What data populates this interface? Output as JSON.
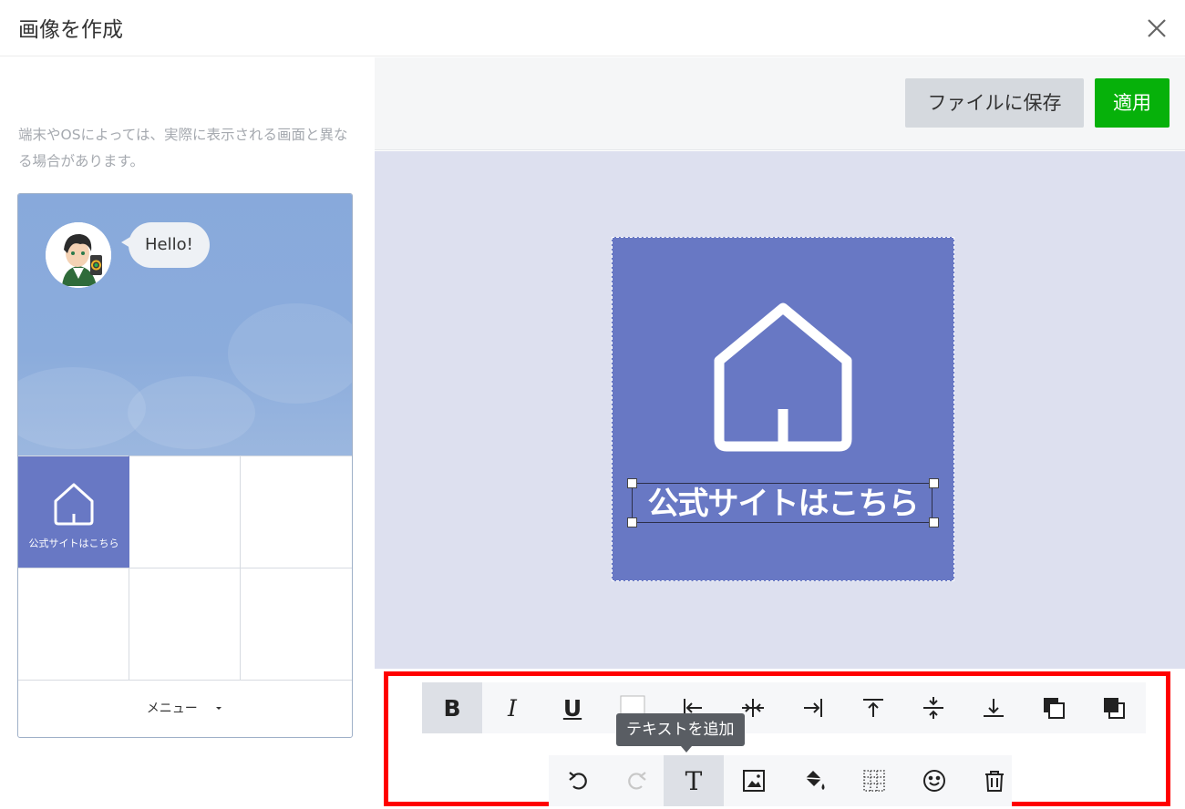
{
  "header": {
    "title": "画像を作成",
    "close_icon": "close-icon"
  },
  "preview": {
    "note": "端末やOSによっては、実際に表示される画面と異なる場合があります。",
    "chat_bubble": "Hello!",
    "cells": [
      {
        "label": "公式サイトはこちら",
        "icon": "home-icon",
        "selected": true
      },
      {
        "label": ""
      },
      {
        "label": ""
      },
      {
        "label": ""
      },
      {
        "label": ""
      },
      {
        "label": ""
      }
    ],
    "menu_label": "メニュー"
  },
  "actions": {
    "save_label": "ファイルに保存",
    "apply_label": "適用"
  },
  "canvas": {
    "text": "公式サイトはこちら",
    "icon": "home-icon",
    "background_color": "#6878c4"
  },
  "toolbar": {
    "row1": [
      "bold",
      "italic",
      "underline",
      "text-color",
      "align-left",
      "align-center",
      "align-right",
      "align-top",
      "align-middle",
      "align-bottom",
      "bring-forward",
      "send-backward"
    ],
    "row2": [
      "undo",
      "redo",
      "add-text",
      "add-image",
      "fill-color",
      "grid",
      "emoji",
      "delete"
    ],
    "tooltip": "テキストを追加"
  },
  "colors": {
    "accent_green": "#06b10a",
    "highlight_frame": "#ff0000"
  }
}
